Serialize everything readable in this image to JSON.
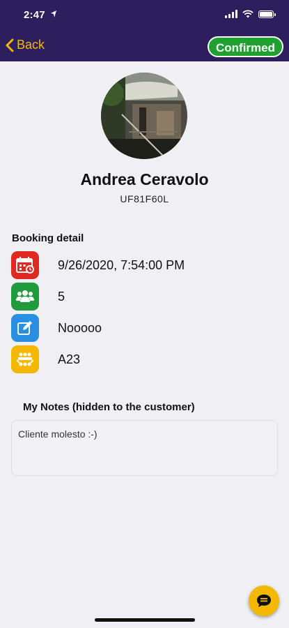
{
  "status_bar": {
    "time": "2:47"
  },
  "nav": {
    "back_label": "Back",
    "status_label": "Confirmed"
  },
  "profile": {
    "name": "Andrea Ceravolo",
    "code": "UF81F60L"
  },
  "booking": {
    "title": "Booking detail",
    "rows": [
      {
        "icon": "calendar-icon",
        "color": "#e02a21",
        "text": "9/26/2020, 7:54:00 PM"
      },
      {
        "icon": "people-icon",
        "color": "#1f9a3c",
        "text": "5"
      },
      {
        "icon": "edit-icon",
        "color": "#2a8fe0",
        "text": "Nooooo"
      },
      {
        "icon": "table-seat-icon",
        "color": "#f5b800",
        "text": "A23"
      }
    ]
  },
  "notes": {
    "title": "My Notes (hidden to the customer)",
    "text": "Cliente molesto :-)"
  },
  "colors": {
    "header": "#2d1f5e",
    "accent": "#f5b800",
    "confirmed": "#1ea12e"
  }
}
